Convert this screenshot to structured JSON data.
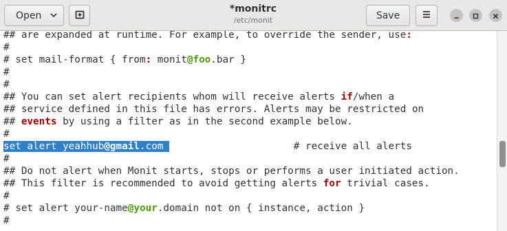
{
  "header": {
    "open_label": "Open",
    "save_label": "Save",
    "title": "*monitrc",
    "subtitle": "/etc/monit"
  },
  "icons": {
    "open_dropdown": "chevron-down-icon",
    "new_tab": "new-tab-icon",
    "menu": "hamburger-menu-icon",
    "minimize": "minimize-icon",
    "maximize": "maximize-icon",
    "close": "close-icon"
  },
  "editor": {
    "lines": [
      {
        "segments": [
          {
            "t": "## are expanded at runtime. For example, to override the sender, use"
          },
          {
            "t": ":",
            "c": "kw"
          }
        ]
      },
      {
        "segments": [
          {
            "t": "#"
          }
        ]
      },
      {
        "segments": [
          {
            "t": "# set mail-format { from"
          },
          {
            "t": ":",
            "c": "kw"
          },
          {
            "t": " monit"
          },
          {
            "t": "@foo",
            "c": "em"
          },
          {
            "t": ".bar }"
          }
        ]
      },
      {
        "segments": [
          {
            "t": "#"
          }
        ]
      },
      {
        "segments": [
          {
            "t": "#"
          }
        ]
      },
      {
        "segments": [
          {
            "t": "## You can set alert recipients whom will receive alerts "
          },
          {
            "t": "if",
            "c": "kw"
          },
          {
            "t": "/when a"
          }
        ]
      },
      {
        "segments": [
          {
            "t": "## service defined in this file has errors. Alerts may be restricted on"
          }
        ]
      },
      {
        "segments": [
          {
            "t": "## "
          },
          {
            "t": "events",
            "c": "kw"
          },
          {
            "t": " by using a filter as in the second example below."
          }
        ]
      },
      {
        "segments": [
          {
            "t": "#"
          }
        ]
      },
      {
        "segments": [
          {
            "t": "set alert yeahhub",
            "c": "hl"
          },
          {
            "t": "@gmail",
            "c": "hl-b"
          },
          {
            "t": ".com ",
            "c": "hl"
          },
          {
            "t": "                     # receive all alerts"
          }
        ]
      },
      {
        "segments": [
          {
            "t": "#"
          }
        ]
      },
      {
        "segments": [
          {
            "t": "## Do not alert when Monit starts, stops or performs a user initiated action."
          }
        ]
      },
      {
        "segments": [
          {
            "t": "## This filter is recommended to avoid getting alerts "
          },
          {
            "t": "for",
            "c": "kw"
          },
          {
            "t": " trivial cases."
          }
        ]
      },
      {
        "segments": [
          {
            "t": "#"
          }
        ]
      },
      {
        "segments": [
          {
            "t": "# set alert your-name"
          },
          {
            "t": "@your",
            "c": "em"
          },
          {
            "t": ".domain not on { instance, action }"
          }
        ]
      },
      {
        "segments": [
          {
            "t": "#"
          }
        ]
      }
    ]
  },
  "colors": {
    "keyword": "#a40000",
    "email_domain": "#4e9a06",
    "selection": "#2f7fc9"
  }
}
